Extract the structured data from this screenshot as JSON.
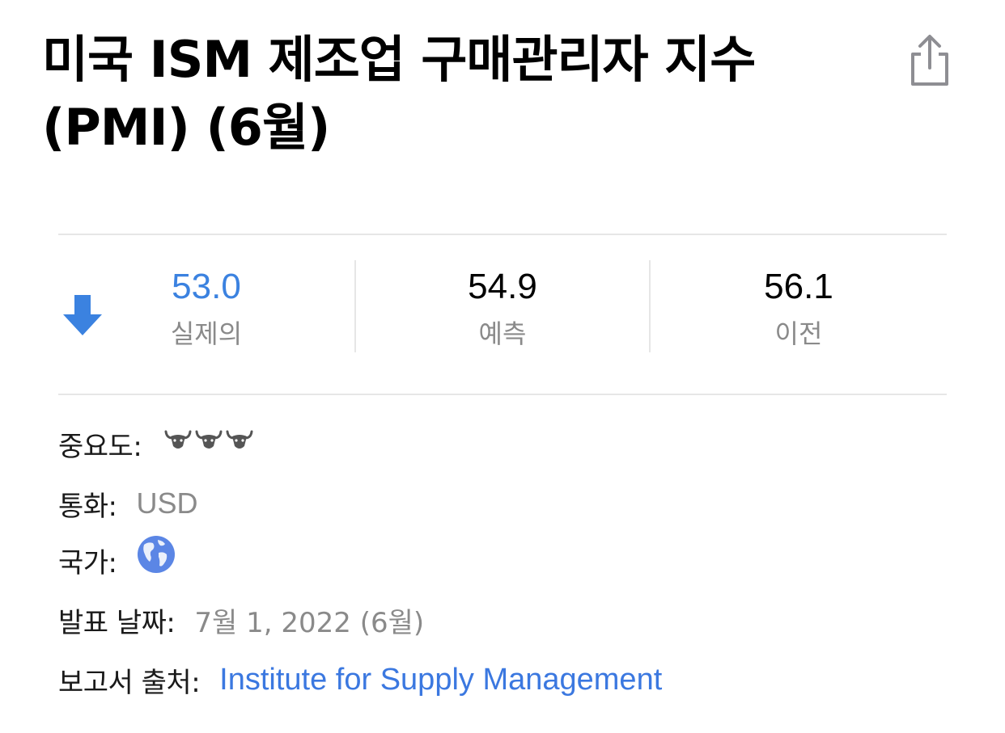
{
  "header": {
    "title": "미국 ISM 제조업 구매관리자 지수 (PMI) (6월)",
    "share_icon": "share-icon"
  },
  "stats": {
    "direction": "down",
    "direction_color": "#3b82e0",
    "actual": {
      "value": "53.0",
      "label": "실제의"
    },
    "forecast": {
      "value": "54.9",
      "label": "예측"
    },
    "previous": {
      "value": "56.1",
      "label": "이전"
    }
  },
  "details": {
    "importance": {
      "label": "중요도:",
      "level": 3,
      "icon": "bull-icon"
    },
    "currency": {
      "label": "통화:",
      "value": "USD"
    },
    "country": {
      "label": "국가:",
      "icon": "globe-icon"
    },
    "release_date": {
      "label": "발표 날짜:",
      "value": "7월 1, 2022 (6월)"
    },
    "source": {
      "label": "보고서 출처:",
      "value": "Institute for Supply Management"
    }
  },
  "colors": {
    "accent": "#3b82e0",
    "link": "#3b78e0",
    "muted": "#8a8a8a",
    "divider": "#e6e6e6"
  }
}
